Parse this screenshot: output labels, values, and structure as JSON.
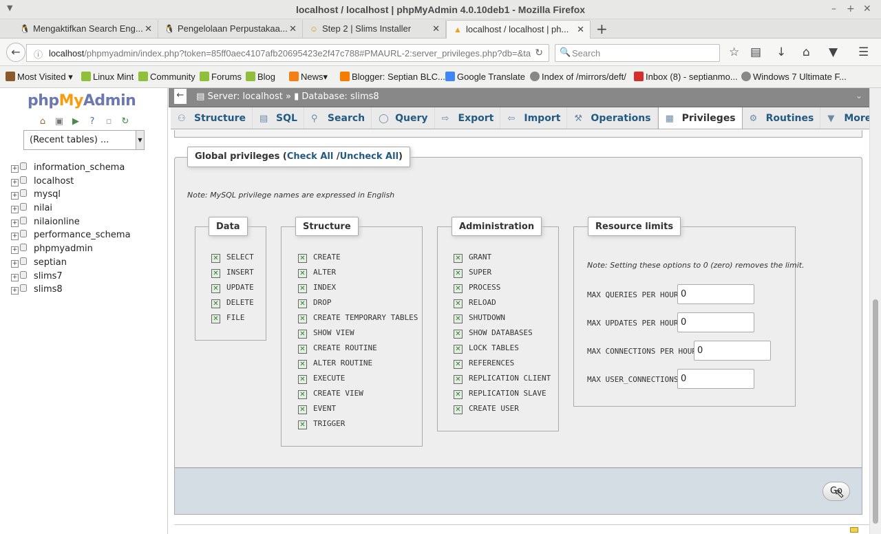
{
  "window": {
    "title": "localhost / localhost | phpMyAdmin 4.0.10deb1 - Mozilla Firefox"
  },
  "tabs": [
    {
      "label": "Mengaktifkan Search Eng...",
      "icon": "tux-icon"
    },
    {
      "label": "Pengelolaan Perpustakaa...",
      "icon": "tux-icon"
    },
    {
      "label": "Step 2 | Slims Installer",
      "icon": "slims-icon"
    },
    {
      "label": "localhost / localhost | ph...",
      "icon": "pma-icon",
      "active": true
    }
  ],
  "navbar": {
    "url_host": "localhost",
    "url_rest": "/phpmyadmin/index.php?token=85ff0aec4107afb20695423e2f47c788#PMAURL-2:server_privileges.php?db=&ta",
    "search_placeholder": "Search"
  },
  "bookmarks": [
    {
      "label": "Most Visited",
      "icon": "gear-icon",
      "color": "#8a5a2b",
      "dropdown": true
    },
    {
      "label": "Linux Mint",
      "icon": "mint-icon",
      "color": "#8fbf3b"
    },
    {
      "label": "Community",
      "icon": "mint-icon",
      "color": "#8fbf3b"
    },
    {
      "label": "Forums",
      "icon": "mint-icon",
      "color": "#8fbf3b"
    },
    {
      "label": "Blog",
      "icon": "mint-icon",
      "color": "#8fbf3b"
    },
    {
      "label": "News",
      "icon": "rss-icon",
      "color": "#f57f17",
      "dropdown": true
    },
    {
      "label": "Blogger: Septian BLC...",
      "icon": "blogger-icon",
      "color": "#f57c00"
    },
    {
      "label": "Google Translate",
      "icon": "translate-icon",
      "color": "#4285f4"
    },
    {
      "label": "Index of /mirrors/deft/",
      "icon": "globe-icon",
      "color": "#888888"
    },
    {
      "label": "Inbox (8) - septianmo...",
      "icon": "gmail-icon",
      "color": "#d32f2f"
    },
    {
      "label": "Windows 7 Ultimate F...",
      "icon": "globe-icon",
      "color": "#888888"
    }
  ],
  "sidebar": {
    "logo": {
      "php": "php",
      "my": "My",
      "admin": "Admin"
    },
    "recent_tables": "(Recent tables) ...",
    "databases": [
      "information_schema",
      "localhost",
      "mysql",
      "nilai",
      "nilaionline",
      "performance_schema",
      "phpmyadmin",
      "septian",
      "slims7",
      "slims8"
    ]
  },
  "breadcrumb": {
    "server": "Server: localhost",
    "sep": "»",
    "database": "Database: slims8"
  },
  "menu": [
    {
      "label": "Structure",
      "icon": "structure-icon"
    },
    {
      "label": "SQL",
      "icon": "sql-icon"
    },
    {
      "label": "Search",
      "icon": "search-icon"
    },
    {
      "label": "Query",
      "icon": "query-icon"
    },
    {
      "label": "Export",
      "icon": "export-icon"
    },
    {
      "label": "Import",
      "icon": "import-icon"
    },
    {
      "label": "Operations",
      "icon": "wrench-icon"
    },
    {
      "label": "Privileges",
      "icon": "privileges-icon",
      "active": true
    },
    {
      "label": "Routines",
      "icon": "routines-icon"
    },
    {
      "label": "More",
      "icon": "chevron-down-icon"
    }
  ],
  "global_privileges": {
    "legend": "Global privileges",
    "open_paren": "(",
    "check_all": "Check All",
    "slash": " /",
    "uncheck_all": "Uncheck All",
    "close_paren": ")",
    "note": "Note: MySQL privilege names are expressed in English"
  },
  "data_group": {
    "legend": "Data",
    "items": [
      "SELECT",
      "INSERT",
      "UPDATE",
      "DELETE",
      "FILE"
    ]
  },
  "structure_group": {
    "legend": "Structure",
    "items": [
      "CREATE",
      "ALTER",
      "INDEX",
      "DROP",
      "CREATE TEMPORARY TABLES",
      "SHOW VIEW",
      "CREATE ROUTINE",
      "ALTER ROUTINE",
      "EXECUTE",
      "CREATE VIEW",
      "EVENT",
      "TRIGGER"
    ]
  },
  "admin_group": {
    "legend": "Administration",
    "items": [
      "GRANT",
      "SUPER",
      "PROCESS",
      "RELOAD",
      "SHUTDOWN",
      "SHOW DATABASES",
      "LOCK TABLES",
      "REFERENCES",
      "REPLICATION CLIENT",
      "REPLICATION SLAVE",
      "CREATE USER"
    ]
  },
  "resource_limits": {
    "legend": "Resource limits",
    "note": "Note: Setting these options to 0 (zero) removes the limit.",
    "rows": [
      {
        "label": "MAX QUERIES PER HOUR",
        "value": "0"
      },
      {
        "label": "MAX UPDATES PER HOUR",
        "value": "0"
      },
      {
        "label": "MAX CONNECTIONS PER HOUR",
        "value": "0"
      },
      {
        "label": "MAX USER_CONNECTIONS",
        "value": "0"
      }
    ]
  },
  "footer": {
    "go_label": "Go"
  }
}
